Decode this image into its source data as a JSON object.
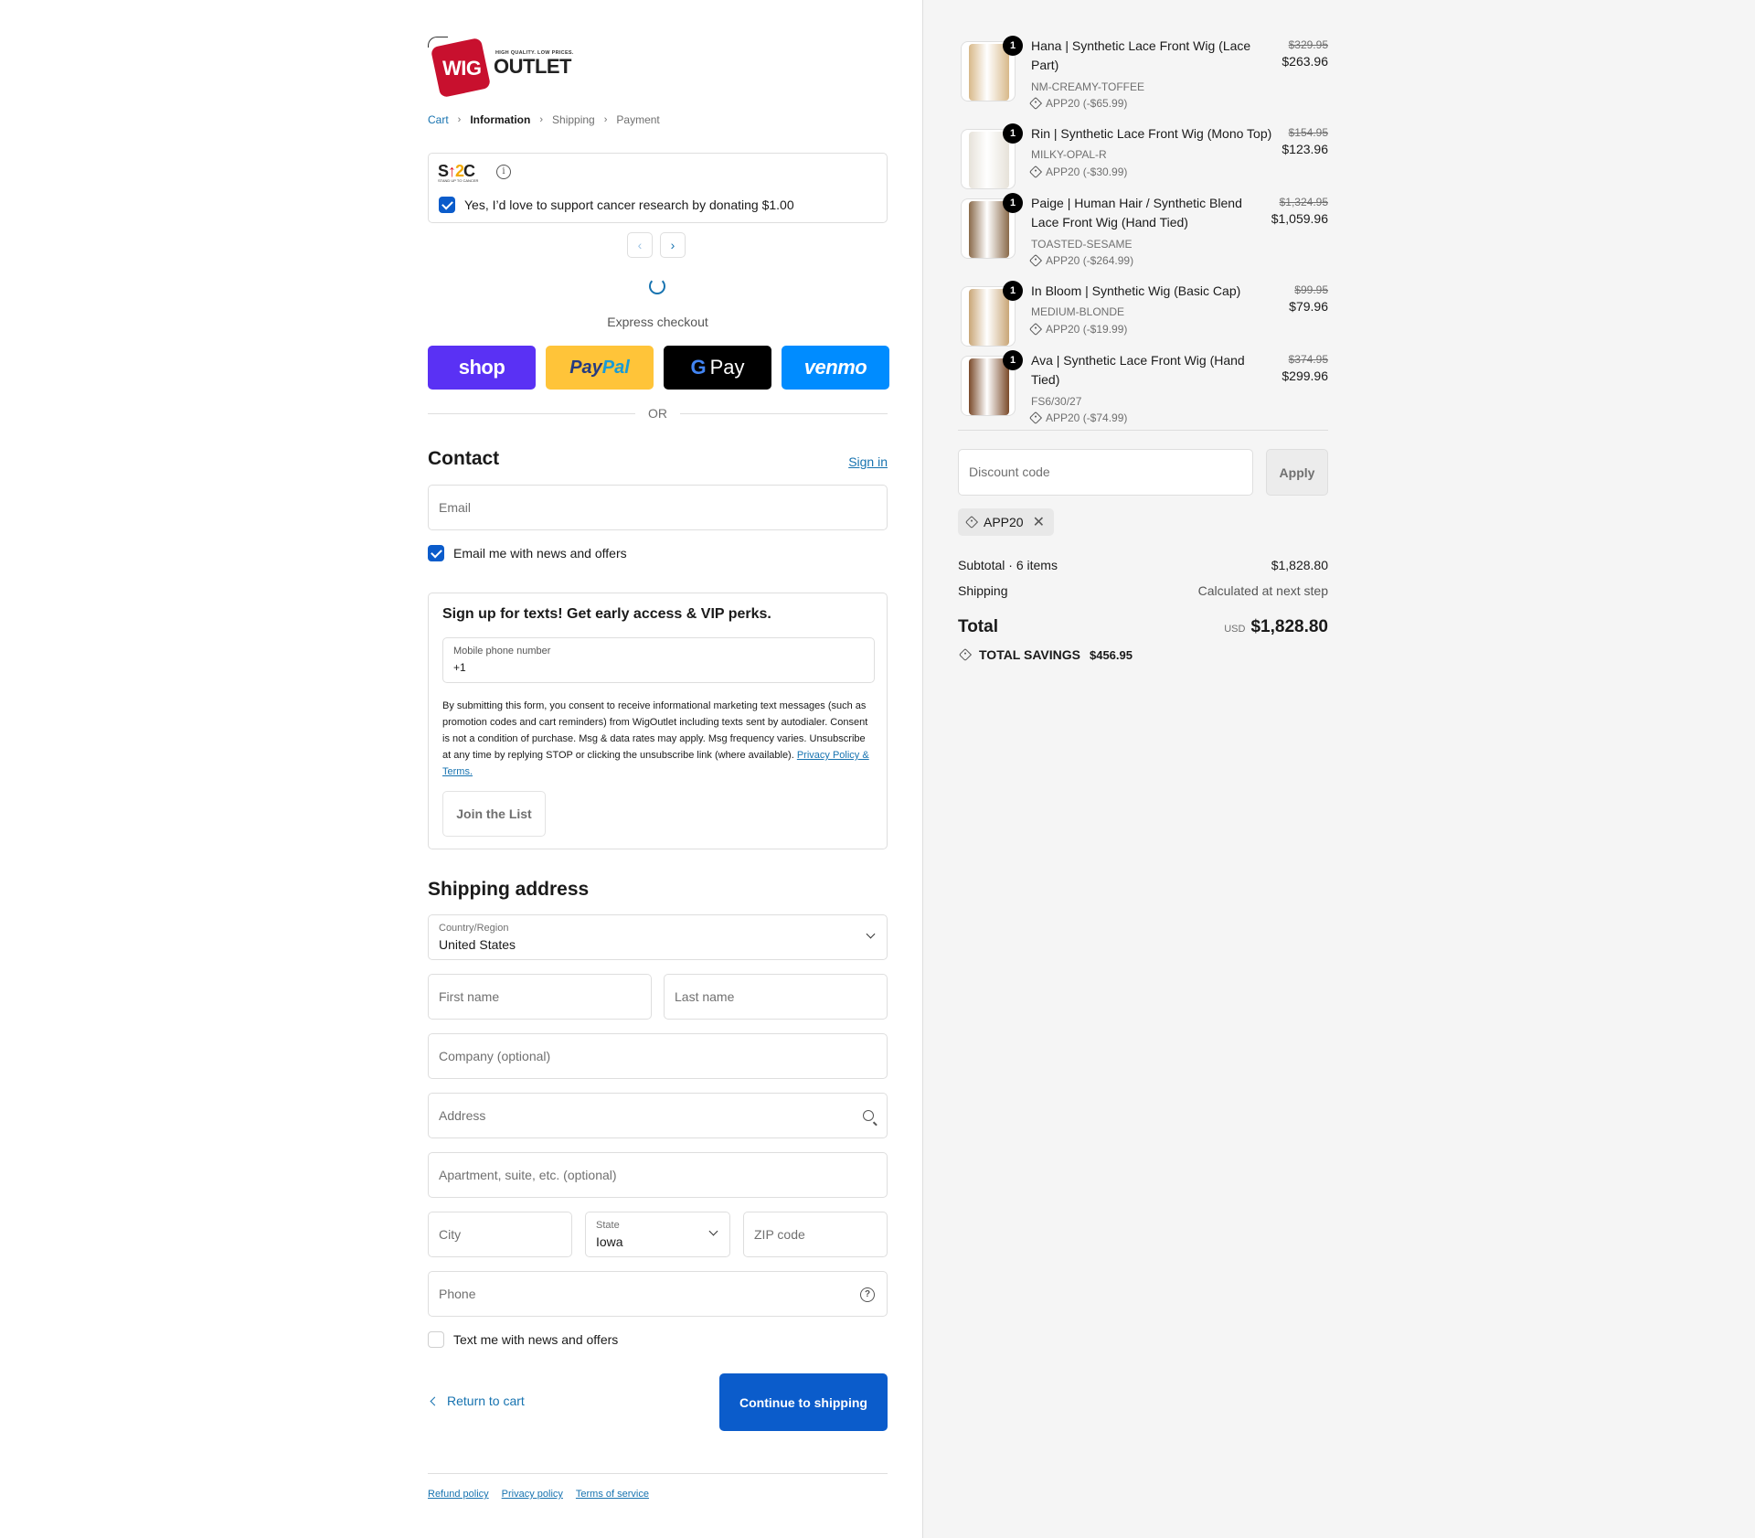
{
  "logo": {
    "word1": "WIG",
    "word2": "OUTLET",
    "tagline": "HIGH QUALITY. LOW PRICES."
  },
  "breadcrumb": [
    "Cart",
    "Information",
    "Shipping",
    "Payment"
  ],
  "donation": {
    "brand": "ST2C",
    "brand_sub": "STAND UP TO CANCER",
    "label": "Yes, I’d love to support cancer research by donating $1.00",
    "checked": true
  },
  "express": {
    "label": "Express checkout",
    "buttons": [
      "shop",
      "PayPal",
      "Pay",
      "venmo"
    ]
  },
  "or_label": "OR",
  "contact": {
    "title": "Contact",
    "sign_in": "Sign in",
    "email_placeholder": "Email",
    "news_label": "Email me with news and offers",
    "news_checked": true
  },
  "sms": {
    "title": "Sign up for texts! Get early access & VIP perks.",
    "phone_label": "Mobile phone number",
    "phone_value": "+1",
    "legal": "By submitting this form, you consent to receive informational marketing text messages (such as promotion codes and cart reminders) from WigOutlet including texts sent by autodialer. Consent is not a condition of purchase. Msg & data rates may apply. Msg frequency varies. Unsubscribe at any time by replying STOP or clicking the unsubscribe link (where available).",
    "legal_link": "Privacy Policy & Terms.",
    "join_label": "Join the List"
  },
  "shipping": {
    "title": "Shipping address",
    "country_label": "Country/Region",
    "country_value": "United States",
    "first_name": "First name",
    "last_name": "Last name",
    "company": "Company (optional)",
    "address": "Address",
    "apartment": "Apartment, suite, etc. (optional)",
    "city": "City",
    "state_label": "State",
    "state_value": "Iowa",
    "zip": "ZIP code",
    "phone": "Phone",
    "text_label": "Text me with news and offers",
    "text_checked": false
  },
  "actions": {
    "return": "Return to cart",
    "continue": "Continue to shipping"
  },
  "footer": [
    "Refund policy",
    "Privacy policy",
    "Terms of service"
  ],
  "cart": {
    "items": [
      {
        "name": "Hana | Synthetic Lace Front Wig (Lace Part)",
        "variant": "NM-CREAMY-TOFFEE",
        "discount": "APP20 (-$65.99)",
        "old_price": "$329.95",
        "price": "$263.96",
        "qty": "1",
        "color": "#d8b98a"
      },
      {
        "name": "Rin | Synthetic Lace Front Wig (Mono Top)",
        "variant": "MILKY-OPAL-R",
        "discount": "APP20 (-$30.99)",
        "old_price": "$154.95",
        "price": "$123.96",
        "qty": "1",
        "color": "#e6e2d9"
      },
      {
        "name": "Paige | Human Hair / Synthetic Blend Lace Front Wig (Hand Tied)",
        "variant": "TOASTED-SESAME",
        "discount": "APP20 (-$264.99)",
        "old_price": "$1,324.95",
        "price": "$1,059.96",
        "qty": "1",
        "color": "#8a6a4a"
      },
      {
        "name": "In Bloom | Synthetic Wig (Basic Cap)",
        "variant": "MEDIUM-BLONDE",
        "discount": "APP20 (-$19.99)",
        "old_price": "$99.95",
        "price": "$79.96",
        "qty": "1",
        "color": "#c9a677"
      },
      {
        "name": "Ava | Synthetic Lace Front Wig (Hand Tied)",
        "variant": "FS6/30/27",
        "discount": "APP20 (-$74.99)",
        "old_price": "$374.95",
        "price": "$299.96",
        "qty": "1",
        "color": "#7a4a2a"
      }
    ],
    "discount_placeholder": "Discount code",
    "apply_label": "Apply",
    "applied_code": "APP20",
    "subtotal_label": "Subtotal · 6 items",
    "subtotal_value": "$1,828.80",
    "shipping_label": "Shipping",
    "shipping_value": "Calculated at next step",
    "total_label": "Total",
    "total_currency": "USD",
    "total_value": "$1,828.80",
    "savings_label": "TOTAL SAVINGS",
    "savings_value": "$456.95"
  }
}
